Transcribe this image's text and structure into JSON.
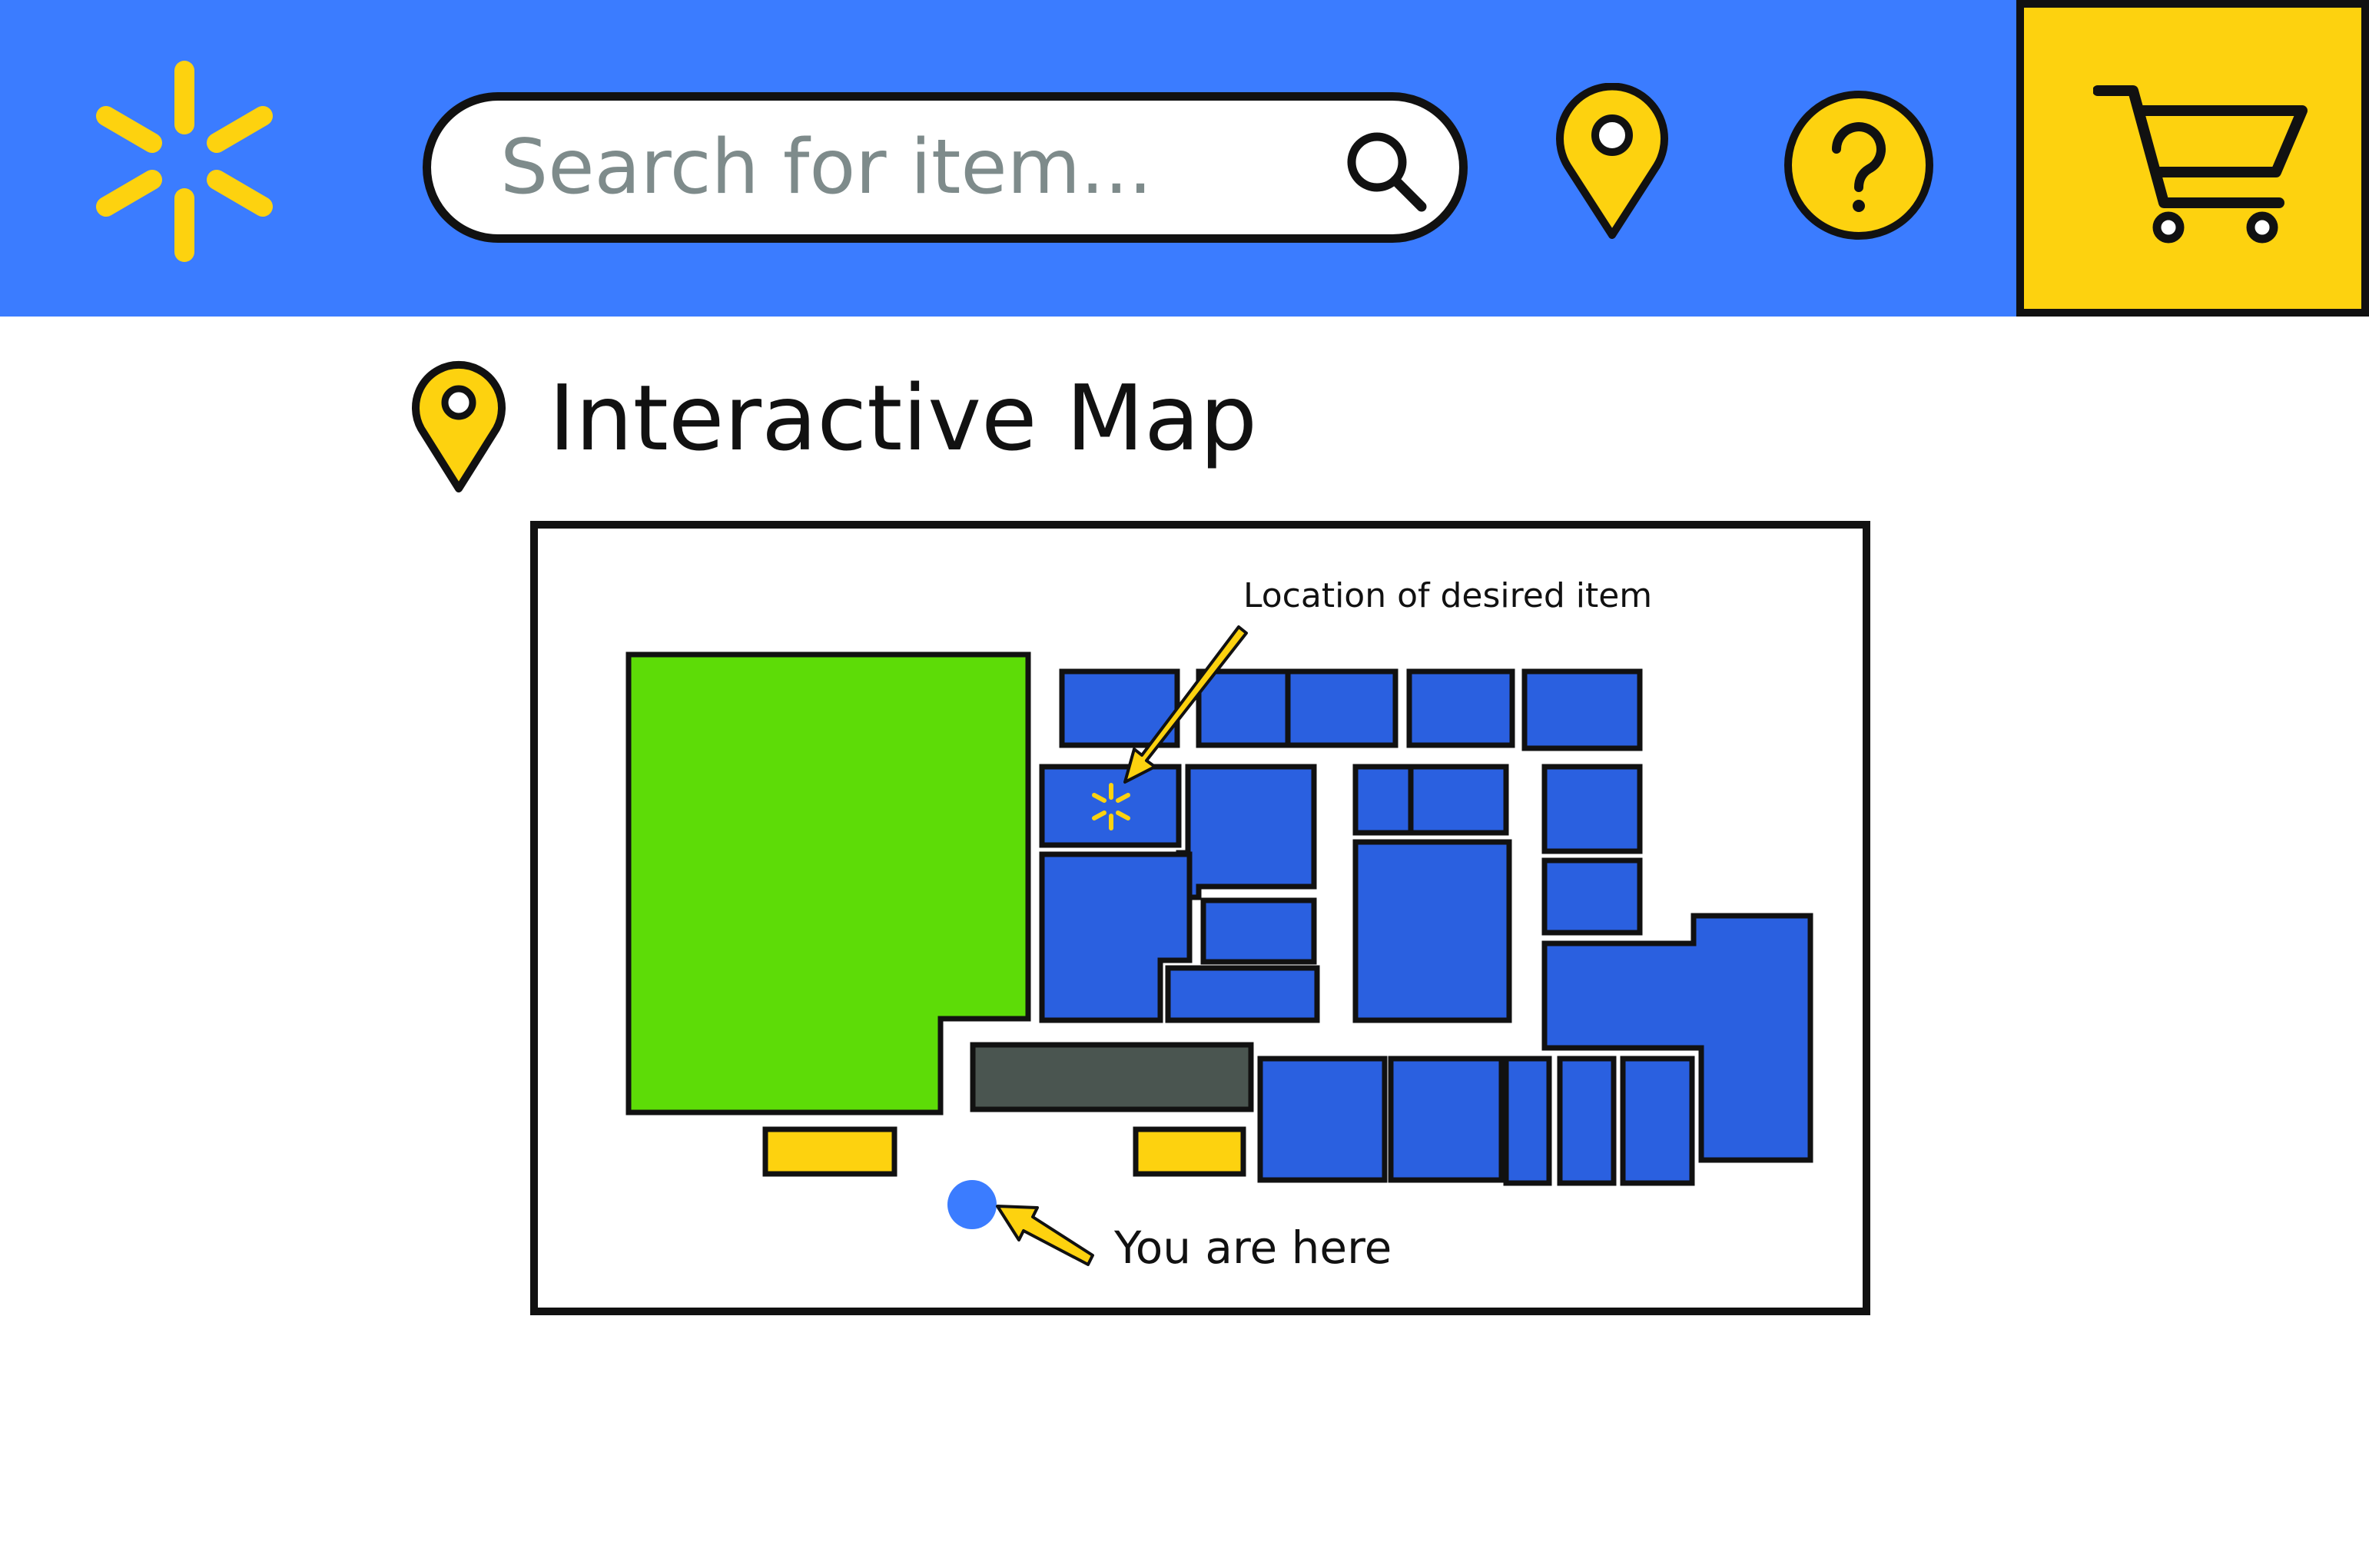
{
  "header": {
    "logo_icon": "spark-icon",
    "search": {
      "placeholder": "Search for item...",
      "value": "",
      "icon": "search-icon"
    },
    "location_icon": "map-pin-icon",
    "help_icon": "question-icon",
    "cart_icon": "shopping-cart-icon"
  },
  "page": {
    "title": "Interactive Map",
    "title_icon": "map-pin-icon"
  },
  "map": {
    "desired_item_label": "Location of desired item",
    "you_are_here_label": "You are here",
    "desired_item_icon": "spark-icon"
  },
  "colors": {
    "header_blue": "#3b7cff",
    "accent_yellow": "#fdd20f",
    "aisle_blue": "#2a60e0",
    "produce_green": "#5ddc07",
    "checkout_gray": "#4a5550",
    "you_dot_blue": "#3b7cff",
    "outline": "#111111"
  }
}
